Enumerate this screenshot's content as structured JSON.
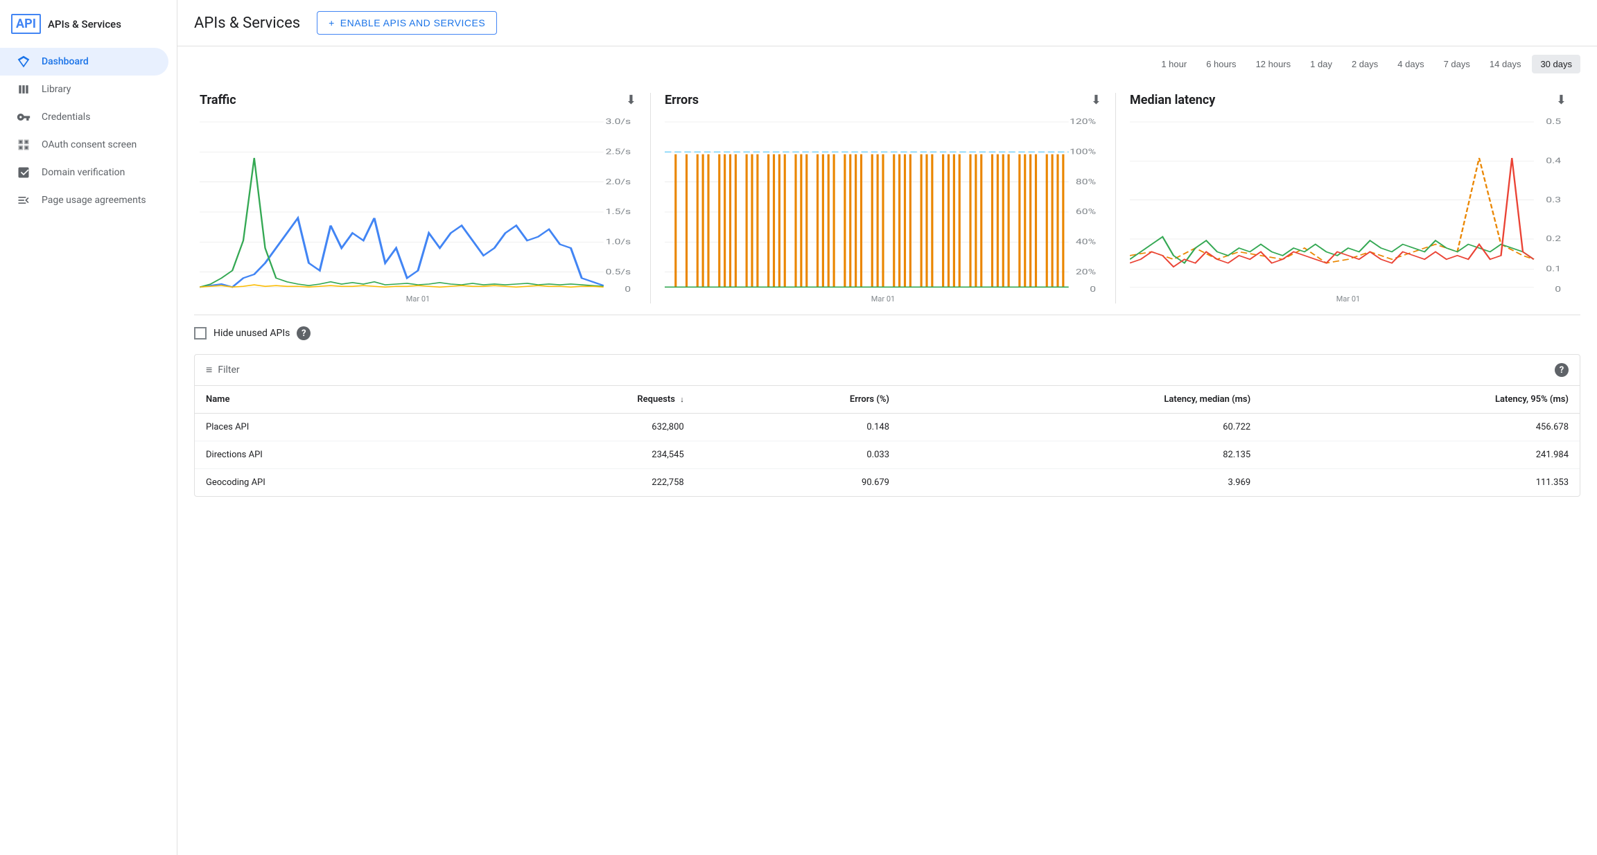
{
  "sidebar": {
    "logo_text": "API",
    "title": "APIs & Services",
    "items": [
      {
        "id": "dashboard",
        "label": "Dashboard",
        "icon": "diamond",
        "active": true
      },
      {
        "id": "library",
        "label": "Library",
        "icon": "library",
        "active": false
      },
      {
        "id": "credentials",
        "label": "Credentials",
        "icon": "key",
        "active": false
      },
      {
        "id": "oauth",
        "label": "OAuth consent screen",
        "icon": "oauth",
        "active": false
      },
      {
        "id": "domain",
        "label": "Domain verification",
        "icon": "domain",
        "active": false
      },
      {
        "id": "page-usage",
        "label": "Page usage agreements",
        "icon": "settings-list",
        "active": false
      }
    ]
  },
  "header": {
    "title": "APIs & Services",
    "enable_button": "ENABLE APIS AND SERVICES"
  },
  "time_range": {
    "options": [
      {
        "label": "1 hour",
        "value": "1h",
        "active": false
      },
      {
        "label": "6 hours",
        "value": "6h",
        "active": false
      },
      {
        "label": "12 hours",
        "value": "12h",
        "active": false
      },
      {
        "label": "1 day",
        "value": "1d",
        "active": false
      },
      {
        "label": "2 days",
        "value": "2d",
        "active": false
      },
      {
        "label": "4 days",
        "value": "4d",
        "active": false
      },
      {
        "label": "7 days",
        "value": "7d",
        "active": false
      },
      {
        "label": "14 days",
        "value": "14d",
        "active": false
      },
      {
        "label": "30 days",
        "value": "30d",
        "active": true
      }
    ]
  },
  "charts": {
    "traffic": {
      "title": "Traffic",
      "x_label": "Mar 01",
      "y_max": "3.0/s",
      "y_labels": [
        "3.0/s",
        "2.5/s",
        "2.0/s",
        "1.5/s",
        "1.0/s",
        "0.5/s",
        "0"
      ]
    },
    "errors": {
      "title": "Errors",
      "x_label": "Mar 01",
      "y_labels": [
        "120%",
        "100%",
        "80%",
        "60%",
        "40%",
        "20%",
        "0"
      ]
    },
    "latency": {
      "title": "Median latency",
      "x_label": "Mar 01",
      "y_labels": [
        "0.5",
        "0.4",
        "0.3",
        "0.2",
        "0.1",
        "0"
      ]
    }
  },
  "hide_unused": {
    "label": "Hide unused APIs",
    "checked": false
  },
  "table": {
    "filter_placeholder": "Filter",
    "columns": [
      {
        "label": "Name",
        "key": "name",
        "sortable": true,
        "sort_dir": "asc",
        "numeric": false
      },
      {
        "label": "Requests",
        "key": "requests",
        "sortable": true,
        "sort_dir": "desc",
        "numeric": true
      },
      {
        "label": "Errors (%)",
        "key": "errors_pct",
        "sortable": false,
        "numeric": true
      },
      {
        "label": "Latency, median (ms)",
        "key": "latency_median",
        "sortable": false,
        "numeric": true
      },
      {
        "label": "Latency, 95% (ms)",
        "key": "latency_95",
        "sortable": false,
        "numeric": true
      }
    ],
    "rows": [
      {
        "name": "Places API",
        "requests": "632,800",
        "errors_pct": "0.148",
        "latency_median": "60.722",
        "latency_95": "456.678"
      },
      {
        "name": "Directions API",
        "requests": "234,545",
        "errors_pct": "0.033",
        "latency_median": "82.135",
        "latency_95": "241.984"
      },
      {
        "name": "Geocoding API",
        "requests": "222,758",
        "errors_pct": "90.679",
        "latency_median": "3.969",
        "latency_95": "111.353"
      }
    ]
  }
}
